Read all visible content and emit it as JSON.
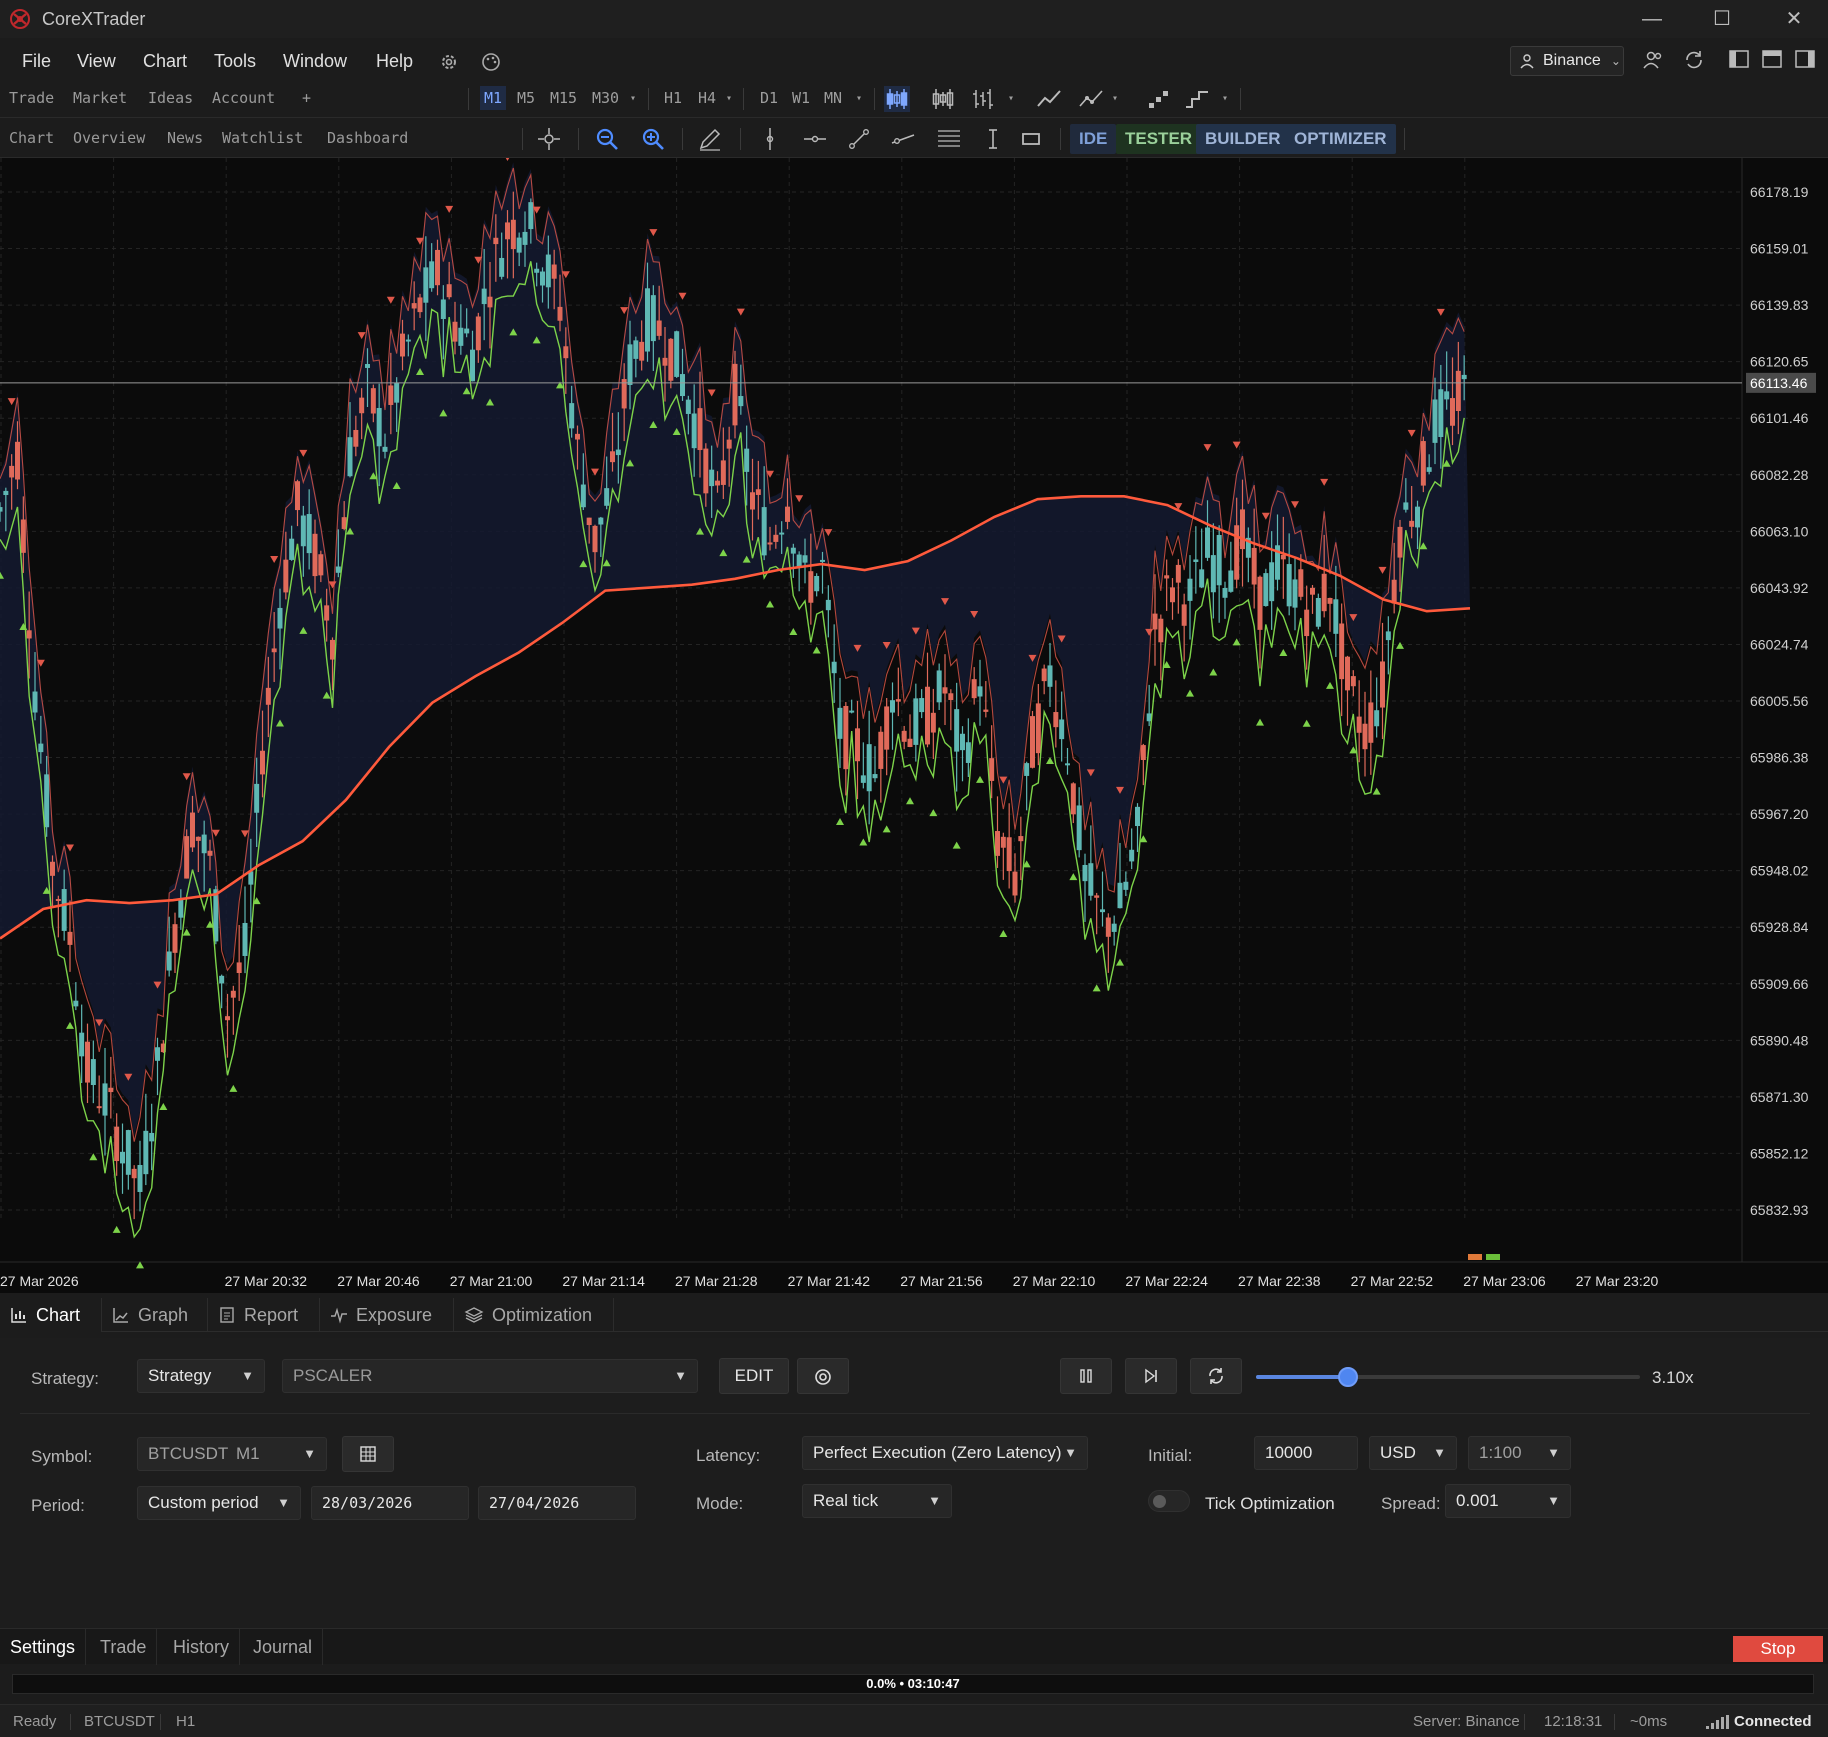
{
  "app": {
    "title": "CoreXTrader"
  },
  "menu": [
    "File",
    "View",
    "Chart",
    "Tools",
    "Window",
    "Help"
  ],
  "exchange": "Binance",
  "nav_row1": [
    "Trade",
    "Market",
    "Ideas",
    "Account",
    "+"
  ],
  "nav_row2": [
    "Chart",
    "Overview",
    "News",
    "Watchlist",
    "Dashboard"
  ],
  "timeframes": [
    "M1",
    "M5",
    "M15",
    "M30",
    "H1",
    "H4",
    "D1",
    "W1",
    "MN"
  ],
  "active_timeframe": "M1",
  "modes": [
    "IDE",
    "TESTER",
    "BUILDER",
    "OPTIMIZER"
  ],
  "active_mode": "TESTER",
  "chart_data": {
    "type": "candlestick",
    "symbol": "BTCUSDT",
    "timeframe": "M1",
    "y_ticks": [
      66178.19,
      66159.01,
      66139.83,
      66120.65,
      66101.46,
      66082.28,
      66063.1,
      66043.92,
      66024.74,
      66005.56,
      65986.38,
      65967.2,
      65948.02,
      65928.84,
      65909.66,
      65890.48,
      65871.3,
      65852.12,
      65832.93
    ],
    "current_price": 66113.46,
    "x_ticks": [
      "27 Mar 2026",
      "27 Mar 20:32",
      "27 Mar 20:46",
      "27 Mar 21:00",
      "27 Mar 21:14",
      "27 Mar 21:28",
      "27 Mar 21:42",
      "27 Mar 21:56",
      "27 Mar 22:10",
      "27 Mar 22:24",
      "27 Mar 22:38",
      "27 Mar 22:52",
      "27 Mar 23:06",
      "27 Mar 23:20"
    ],
    "price_path": [
      66070,
      66090,
      66010,
      65950,
      65925,
      65880,
      65870,
      65855,
      65840,
      65880,
      65930,
      65965,
      65950,
      65900,
      65920,
      65990,
      66040,
      66070,
      66055,
      66030,
      66090,
      66110,
      66095,
      66120,
      66140,
      66150,
      66135,
      66125,
      66150,
      66165,
      66170,
      66155,
      66140,
      66090,
      66060,
      66080,
      66120,
      66135,
      66130,
      66115,
      66095,
      66070,
      66110,
      66075,
      66060,
      66075,
      66045,
      66050,
      65995,
      65990,
      65980,
      66010,
      65995,
      66000,
      66010,
      65985,
      66015,
      65960,
      65945,
      65990,
      66015,
      65990,
      65945,
      65930,
      65935,
      65960,
      66030,
      66045,
      66040,
      66055,
      66050,
      66060,
      66040,
      66050,
      66045,
      66035,
      66045,
      66010,
      65995,
      66010,
      66065,
      66075,
      66100,
      66105,
      66113
    ],
    "ma_path": [
      65925,
      65935,
      65938,
      65937,
      65938,
      65940,
      65950,
      65958,
      65972,
      65990,
      66005,
      66014,
      66022,
      66032,
      66043,
      66044,
      66045,
      66047,
      66050,
      66052,
      66050,
      66053,
      66060,
      66068,
      66074,
      66075,
      66075,
      66072,
      66065,
      66059,
      66054,
      66048,
      66040,
      66036,
      66037
    ]
  },
  "bottom_tabs": [
    "Chart",
    "Graph",
    "Report",
    "Exposure",
    "Optimization"
  ],
  "strategy": {
    "label": "Strategy:",
    "type": "Strategy",
    "name": "PSCALER",
    "edit": "EDIT",
    "speed": "3.10x",
    "speed_fraction": 0.24
  },
  "symbol": {
    "label": "Symbol:",
    "value": "BTCUSDT",
    "tf": "M1"
  },
  "period": {
    "label": "Period:",
    "value": "Custom period",
    "from": "28/03/2026",
    "to": "27/04/2026"
  },
  "latency": {
    "label": "Latency:",
    "value": "Perfect Execution (Zero Latency)"
  },
  "mode": {
    "label": "Mode:",
    "value": "Real tick"
  },
  "initial": {
    "label": "Initial:",
    "value": "10000",
    "currency": "USD",
    "leverage": "1:100"
  },
  "tick_opt": "Tick Optimization",
  "spread": {
    "label": "Spread:",
    "value": "0.001"
  },
  "panel_tabs": [
    "Settings",
    "Trade",
    "History",
    "Journal"
  ],
  "stop": "Stop",
  "progress": "0.0% • 03:10:47",
  "status": {
    "ready": "Ready",
    "symbol": "BTCUSDT",
    "tf": "H1",
    "server": "Server: Binance",
    "time": "12:18:31",
    "ping": "~0ms",
    "conn": "Connected"
  },
  "colors": {
    "up": "#5fb8b4",
    "down": "#e06a5a",
    "ma": "#ff5a3c",
    "accent": "#7fa8ff"
  }
}
